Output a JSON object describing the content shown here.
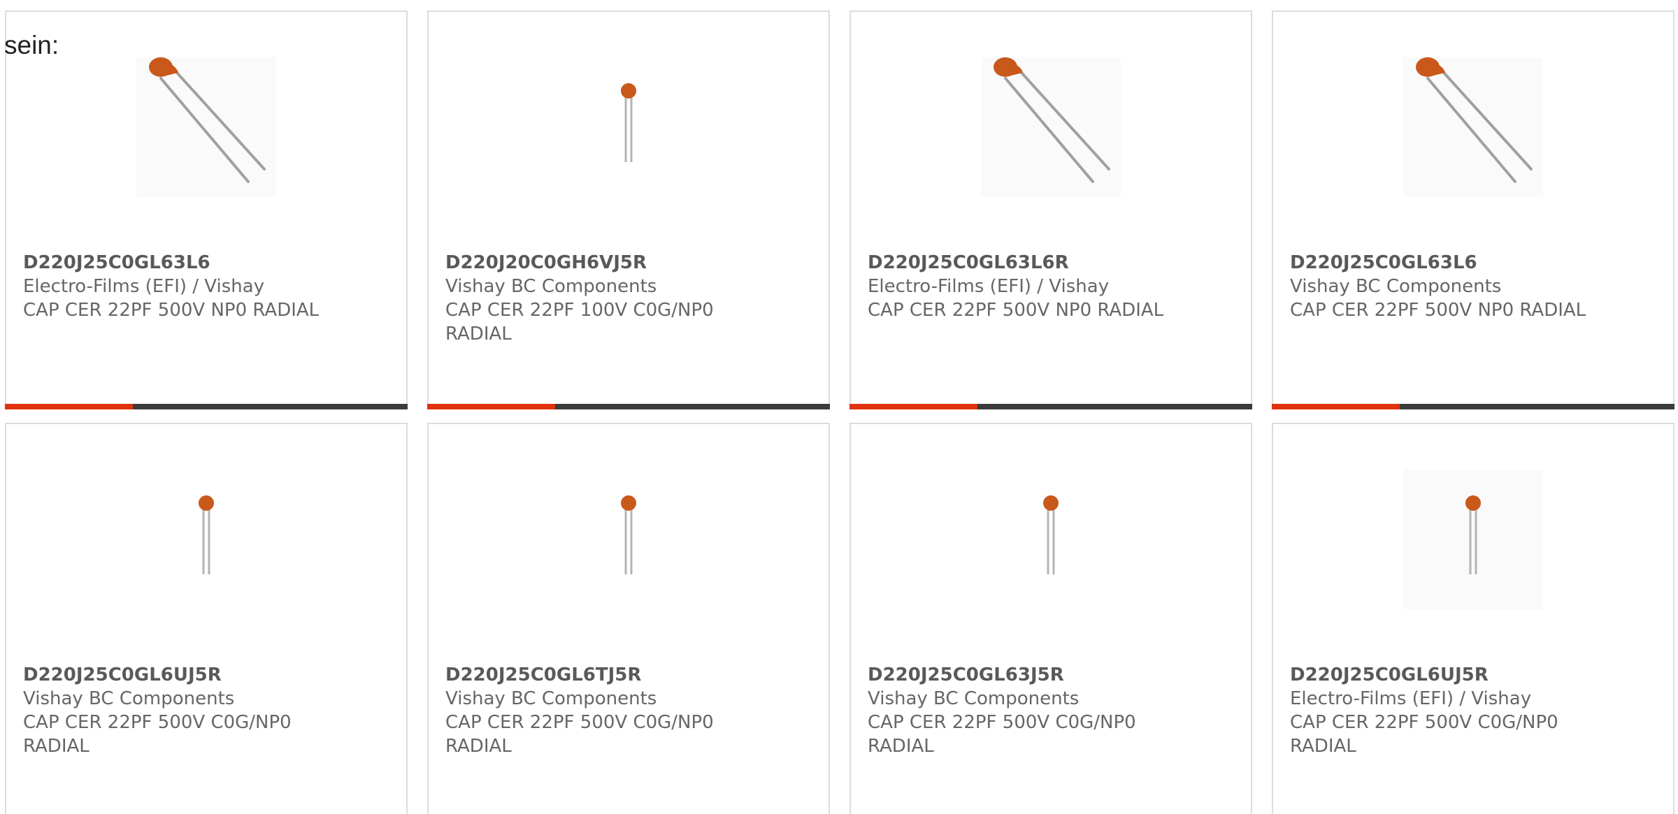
{
  "intro_text": "sein:",
  "colors": {
    "accent": "#e0320e",
    "bar": "#3b3b3b",
    "capacitor": "#c8591b"
  },
  "products": [
    {
      "part_number": "D220J25C0GL63L6",
      "manufacturer": "Electro-Films (EFI) / Vishay",
      "description": "CAP CER 22PF 500V NP0 RADIAL",
      "image_icon": "capacitor-angled-image"
    },
    {
      "part_number": "D220J20C0GH6VJ5R",
      "manufacturer": "Vishay BC Components",
      "description": "CAP CER 22PF 100V C0G/NP0 RADIAL",
      "image_icon": "capacitor-small-image"
    },
    {
      "part_number": "D220J25C0GL63L6R",
      "manufacturer": "Electro-Films (EFI) / Vishay",
      "description": "CAP CER 22PF 500V NP0 RADIAL",
      "image_icon": "capacitor-angled-image"
    },
    {
      "part_number": "D220J25C0GL63L6",
      "manufacturer": "Vishay BC Components",
      "description": "CAP CER 22PF 500V NP0 RADIAL",
      "image_icon": "capacitor-angled-image"
    },
    {
      "part_number": "D220J25C0GL6UJ5R",
      "manufacturer": "Vishay BC Components",
      "description": "CAP CER 22PF 500V C0G/NP0 RADIAL",
      "image_icon": "capacitor-small-image"
    },
    {
      "part_number": "D220J25C0GL6TJ5R",
      "manufacturer": "Vishay BC Components",
      "description": "CAP CER 22PF 500V C0G/NP0 RADIAL",
      "image_icon": "capacitor-small-image"
    },
    {
      "part_number": "D220J25C0GL63J5R",
      "manufacturer": "Vishay BC Components",
      "description": "CAP CER 22PF 500V C0G/NP0 RADIAL",
      "image_icon": "capacitor-small-image"
    },
    {
      "part_number": "D220J25C0GL6UJ5R",
      "manufacturer": "Electro-Films (EFI) / Vishay",
      "description": "CAP CER 22PF 500V C0G/NP0 RADIAL",
      "image_icon": "capacitor-small-image"
    }
  ]
}
